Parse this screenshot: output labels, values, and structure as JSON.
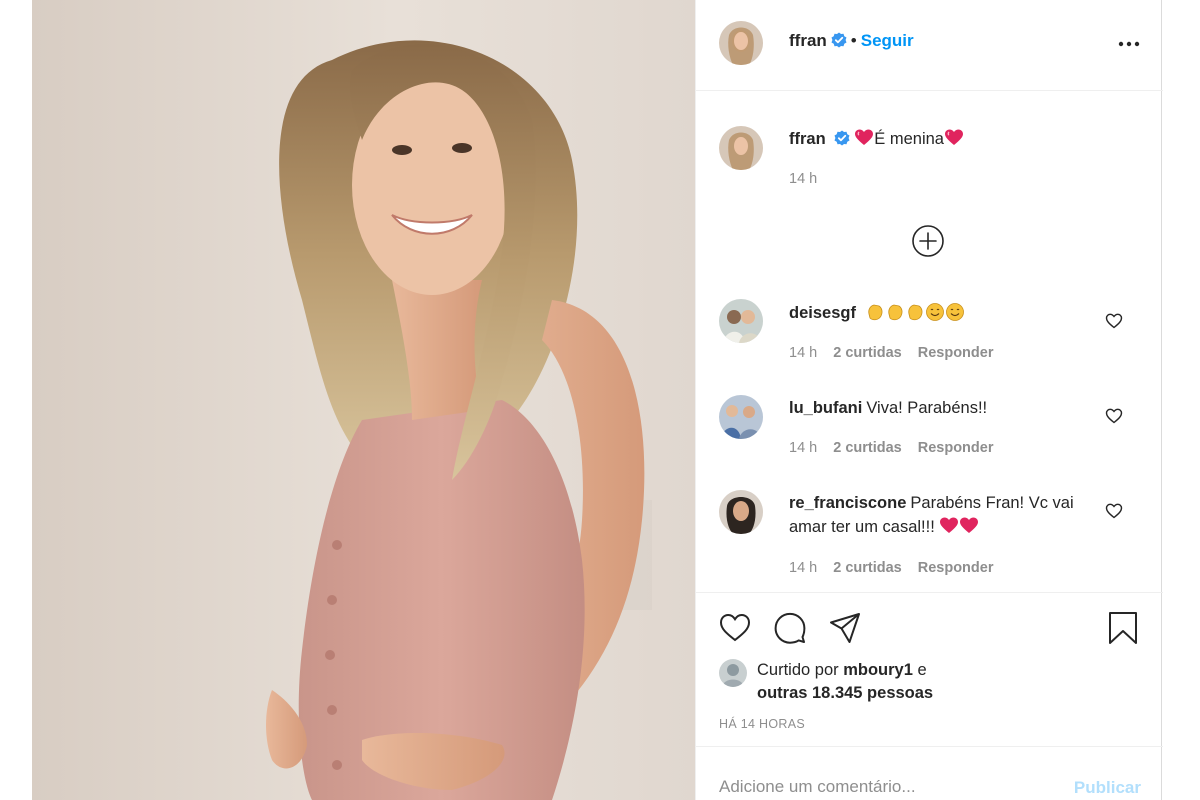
{
  "post": {
    "author": {
      "username": "ffran",
      "verified": true
    },
    "follow_label": "Seguir",
    "caption": {
      "text": "É menina",
      "time": "14 h"
    },
    "comments": [
      {
        "username": "deisesgf",
        "text": "",
        "emojis": [
          "clap",
          "clap",
          "clap",
          "smile",
          "smile"
        ],
        "time": "14 h",
        "likes": "2 curtidas",
        "reply": "Responder"
      },
      {
        "username": "lu_bufani",
        "text": "Viva! Parabéns!!",
        "time": "14 h",
        "likes": "2 curtidas",
        "reply": "Responder"
      },
      {
        "username": "re_franciscone",
        "text": "Parabéns Fran! Vc vai amar ter um casal!!!",
        "time": "14 h",
        "likes": "2 curtidas",
        "reply": "Responder"
      }
    ],
    "likes": {
      "prefix": "Curtido por",
      "user": "mboury1",
      "joiner": "e",
      "others": "outras 18.345 pessoas"
    },
    "time_ago": "HÁ 14 HORAS",
    "comment_placeholder": "Adicione um comentário...",
    "publish_label": "Publicar"
  },
  "icons": {
    "verified": "verified-badge-icon",
    "more": "more-options-icon",
    "load_more": "load-more-comments-icon",
    "like": "heart-icon",
    "comment": "comment-icon",
    "share": "share-icon",
    "save": "bookmark-icon"
  },
  "colors": {
    "link": "#0095f6",
    "muted": "#8e8e8e",
    "text": "#262626",
    "publish_disabled": "#b2dffc",
    "heart_emoji": "#e0245e"
  }
}
